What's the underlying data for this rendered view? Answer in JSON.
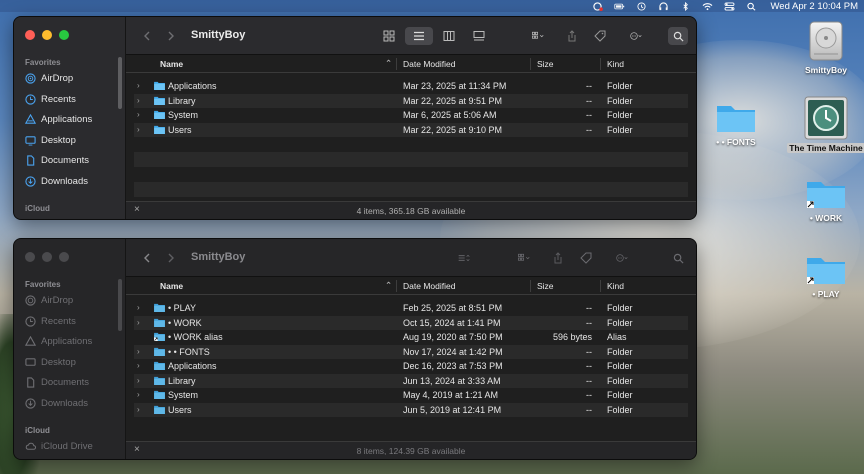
{
  "menubar": {
    "clock": "Wed Apr 2  10:04 PM",
    "icons": [
      "creative-cloud-icon",
      "battery-icon",
      "time-machine-icon",
      "headphones-icon",
      "bluetooth-icon",
      "wifi-icon",
      "control-center-icon",
      "search-icon"
    ]
  },
  "desktop_icons": [
    {
      "label": "SmittyBoy",
      "icon": "hard-drive-icon"
    },
    {
      "label": "• • FONTS",
      "icon": "folder-icon"
    },
    {
      "label": "The Time Machine",
      "icon": "time-machine-icon"
    },
    {
      "label": "• WORK",
      "icon": "folder-alias-icon"
    },
    {
      "label": "• PLAY",
      "icon": "folder-alias-icon"
    }
  ],
  "windows": [
    {
      "title": "SmittyBoy",
      "sidebar": {
        "favorites_label": "Favorites",
        "items": [
          {
            "label": "AirDrop",
            "icon": "airdrop-icon"
          },
          {
            "label": "Recents",
            "icon": "clock-icon"
          },
          {
            "label": "Applications",
            "icon": "applications-icon"
          },
          {
            "label": "Desktop",
            "icon": "desktop-icon"
          },
          {
            "label": "Documents",
            "icon": "document-icon"
          },
          {
            "label": "Downloads",
            "icon": "download-icon"
          }
        ],
        "icloud_label": "iCloud"
      },
      "columns": {
        "name": "Name",
        "date": "Date Modified",
        "size": "Size",
        "kind": "Kind"
      },
      "rows": [
        {
          "name": "Applications",
          "date": "Mar 23, 2025 at 11:34 PM",
          "size": "--",
          "kind": "Folder"
        },
        {
          "name": "Library",
          "date": "Mar 22, 2025 at 9:51 PM",
          "size": "--",
          "kind": "Folder"
        },
        {
          "name": "System",
          "date": "Mar 6, 2025 at 5:06 AM",
          "size": "--",
          "kind": "Folder"
        },
        {
          "name": "Users",
          "date": "Mar 22, 2025 at 9:10 PM",
          "size": "--",
          "kind": "Folder"
        }
      ],
      "status": "4 items, 365.18 GB available",
      "view_mode": "list"
    },
    {
      "title": "SmittyBoy",
      "sidebar": {
        "favorites_label": "Favorites",
        "items": [
          {
            "label": "AirDrop",
            "icon": "airdrop-icon"
          },
          {
            "label": "Recents",
            "icon": "clock-icon"
          },
          {
            "label": "Applications",
            "icon": "applications-icon"
          },
          {
            "label": "Desktop",
            "icon": "desktop-icon"
          },
          {
            "label": "Documents",
            "icon": "document-icon"
          },
          {
            "label": "Downloads",
            "icon": "download-icon"
          }
        ],
        "icloud_label": "iCloud",
        "icloud_drive": "iCloud Drive"
      },
      "columns": {
        "name": "Name",
        "date": "Date Modified",
        "size": "Size",
        "kind": "Kind"
      },
      "rows": [
        {
          "name": "• PLAY",
          "date": "Feb 25, 2025 at 8:51 PM",
          "size": "--",
          "kind": "Folder"
        },
        {
          "name": "• WORK",
          "date": "Oct 15, 2024 at 1:41 PM",
          "size": "--",
          "kind": "Folder"
        },
        {
          "name": "• WORK alias",
          "date": "Aug 19, 2020 at 7:50 PM",
          "size": "596 bytes",
          "kind": "Alias"
        },
        {
          "name": "• • FONTS",
          "date": "Nov 17, 2024 at 1:42 PM",
          "size": "--",
          "kind": "Folder"
        },
        {
          "name": "Applications",
          "date": "Dec 16, 2023 at 7:53 PM",
          "size": "--",
          "kind": "Folder"
        },
        {
          "name": "Library",
          "date": "Jun 13, 2024 at 3:33 AM",
          "size": "--",
          "kind": "Folder"
        },
        {
          "name": "System",
          "date": "May 4, 2019 at 1:21 AM",
          "size": "--",
          "kind": "Folder"
        },
        {
          "name": "Users",
          "date": "Jun 5, 2019 at 12:41 PM",
          "size": "--",
          "kind": "Folder"
        }
      ],
      "status": "8 items, 124.39 GB available",
      "view_mode": "list"
    }
  ],
  "colors": {
    "folder_blue": "#4ab3ef",
    "accent": "#3b82f6",
    "close": "#ff5f57",
    "minimize": "#febc2e",
    "maximize": "#28c840",
    "inactive_dot": "#4a4a4d"
  }
}
